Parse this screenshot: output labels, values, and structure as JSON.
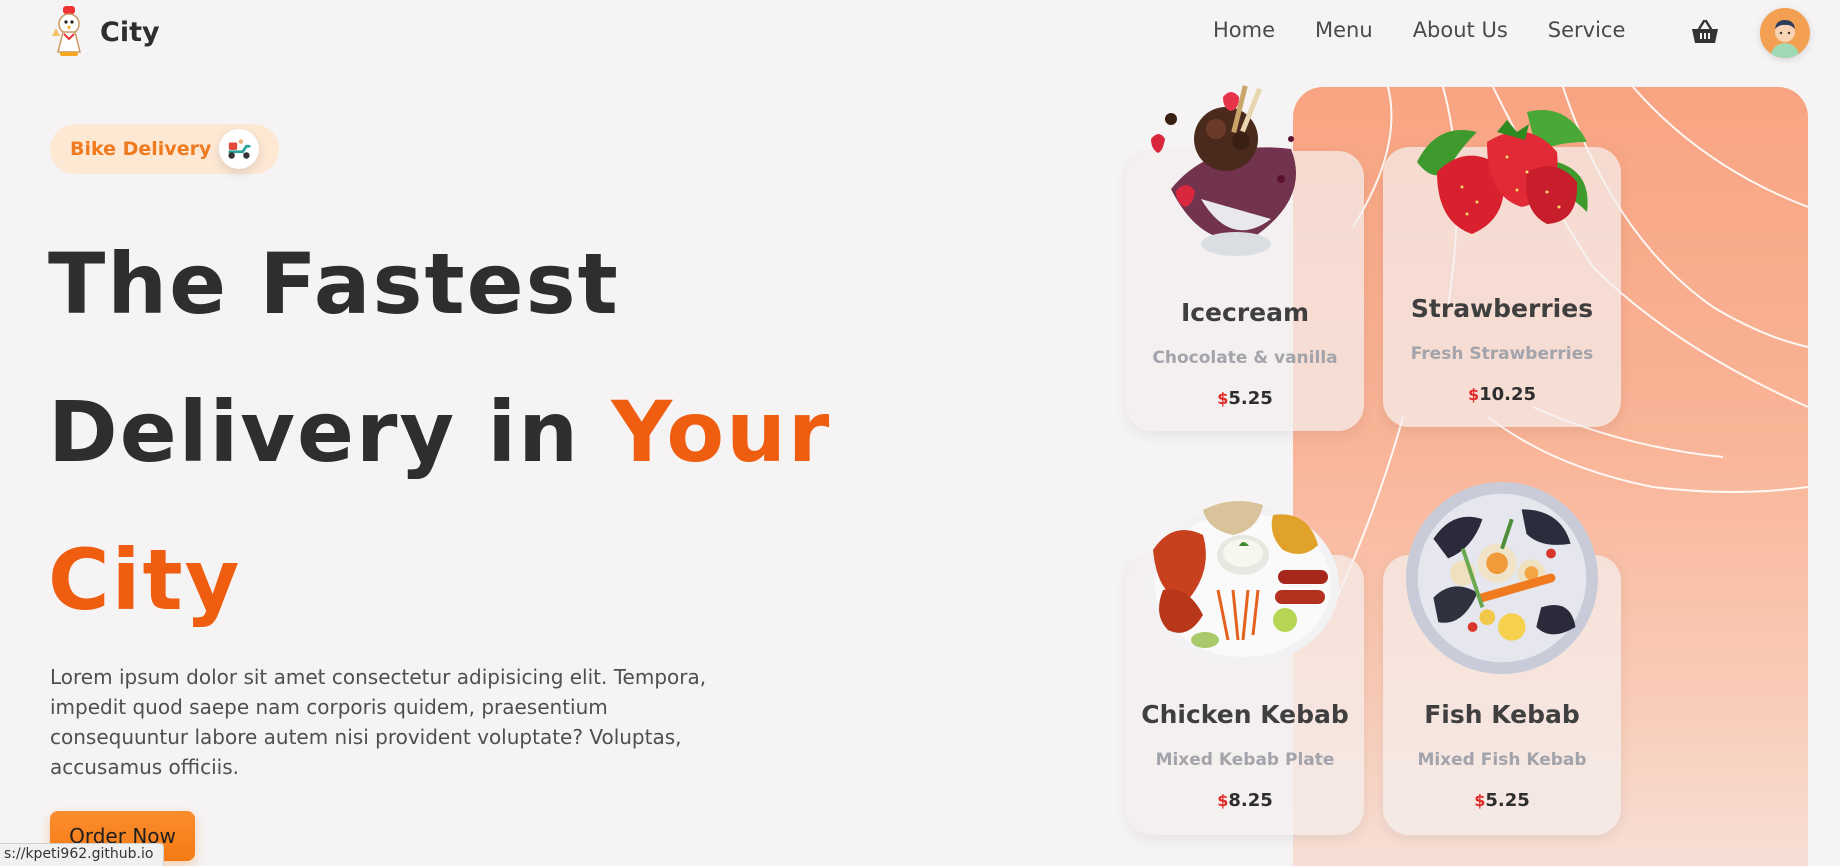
{
  "header": {
    "brand_name": "City",
    "logo_icon": "chef-chicken-logo",
    "nav": [
      "Home",
      "Menu",
      "About Us",
      "Service"
    ],
    "cart_icon": "basket-icon",
    "avatar_icon": "user-avatar"
  },
  "hero": {
    "badge_text": "Bike Delivery",
    "badge_icon": "scooter-icon",
    "title_part1": "The Fastest",
    "title_part2": "Delivery in ",
    "title_highlight1": "Your",
    "title_highlight2": "City",
    "description": "Lorem ipsum dolor sit amet consectetur adipisicing elit. Tempora, impedit quod saepe nam corporis quidem, praesentium consequuntur labore autem nisi provident voluptate? Voluptas, accusamus officiis.",
    "cta_label": "Order Now"
  },
  "status_bar": {
    "url": "s://kpeti962.github.io"
  },
  "colors": {
    "accent": "#ef5d10",
    "button": "#f57a14",
    "panel": "#f9b497",
    "currency": "#e32a2a"
  },
  "cards": [
    {
      "name": "Icecream",
      "sub": "Chocolate & vanilla",
      "currency": "$",
      "price": "5.25",
      "image": "chocolate-icecream"
    },
    {
      "name": "Strawberries",
      "sub": "Fresh Strawberries",
      "currency": "$",
      "price": "10.25",
      "image": "strawberries"
    },
    {
      "name": "Chicken Kebab",
      "sub": "Mixed Kebab Plate",
      "currency": "$",
      "price": "8.25",
      "image": "kebab-plate"
    },
    {
      "name": "Fish Kebab",
      "sub": "Mixed Fish Kebab",
      "currency": "$",
      "price": "5.25",
      "image": "seafood-plate"
    }
  ]
}
